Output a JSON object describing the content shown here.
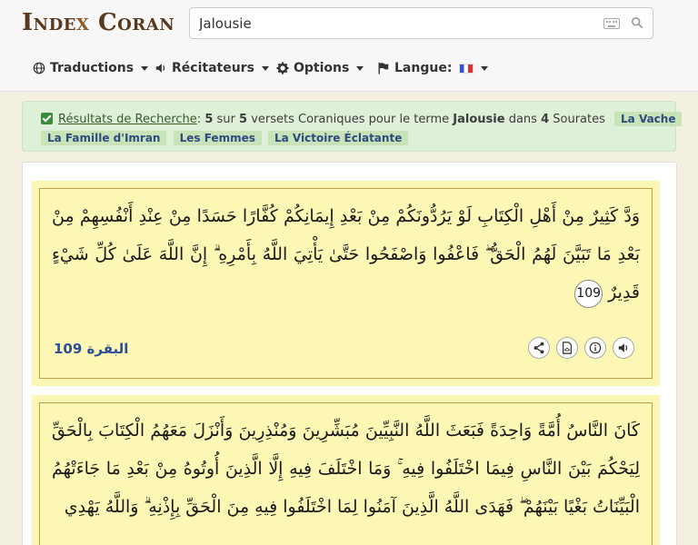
{
  "header": {
    "logo": {
      "part1": "Inde",
      "x": "x",
      "part2": " Coran"
    },
    "search": {
      "value": "Jalousie"
    },
    "nav": {
      "translations": "Traductions",
      "reciters": "Récitateurs",
      "options": "Options",
      "language": "Langue:"
    }
  },
  "results": {
    "link": "Résultats de Recherche",
    "colon": ":",
    "count": "5",
    "sur": "sur",
    "total": "5",
    "verses_text": "versets Coraniques pour le terme",
    "term": "Jalousie",
    "dans": "dans",
    "surah_count": "4",
    "surahs_word": "Sourates",
    "surahs": [
      "La Vache",
      "La Famille d'Imran",
      "Les Femmes",
      "La Victoire Éclatante"
    ]
  },
  "verses": [
    {
      "text": "وَدَّ كَثِيرٌ مِنْ أَهْلِ الْكِتَابِ لَوْ يَرُدُّونَكُمْ مِنْ بَعْدِ إِيمَانِكُمْ كُفَّارًا حَسَدًا مِنْ عِنْدِ أَنْفُسِهِمْ مِنْ بَعْدِ مَا تَبَيَّنَ لَهُمُ الْحَقُّ ۖ فَاعْفُوا وَاصْفَحُوا حَتَّىٰ يَأْتِيَ اللَّهُ بِأَمْرِهِ ۗ إِنَّ اللَّهَ عَلَىٰ كُلِّ شَيْءٍ قَدِيرٌ",
      "number": "109",
      "reference": "البقرة 109"
    },
    {
      "text": "كَانَ النَّاسُ أُمَّةً وَاحِدَةً فَبَعَثَ اللَّهُ النَّبِيِّينَ مُبَشِّرِينَ وَمُنْذِرِينَ وَأَنْزَلَ مَعَهُمُ الْكِتَابَ بِالْحَقِّ لِيَحْكُمَ بَيْنَ النَّاسِ فِيمَا اخْتَلَفُوا فِيهِ ۚ وَمَا اخْتَلَفَ فِيهِ إِلَّا الَّذِينَ أُوتُوهُ مِنْ بَعْدِ مَا جَاءَتْهُمُ الْبَيِّنَاتُ بَغْيًا بَيْنَهُمْ ۖ فَهَدَى اللَّهُ الَّذِينَ آمَنُوا لِمَا اخْتَلَفُوا فِيهِ مِنَ الْحَقِّ بِإِذْنِهِ ۗ وَاللَّهُ يَهْدِي"
    }
  ],
  "icons": [
    "keyboard-icon",
    "search-icon",
    "globe-icon",
    "volume-icon",
    "gear-icon",
    "flag-icon",
    "share-icon",
    "pdf-icon",
    "info-icon",
    "audio-icon"
  ],
  "colors": {
    "alert_bg": "#dff0d8",
    "tag_bg": "#c9e3b8",
    "verse_bg": "#fcf7b4",
    "reference": "#2d4f9a",
    "logo": "#5a3a1e"
  }
}
